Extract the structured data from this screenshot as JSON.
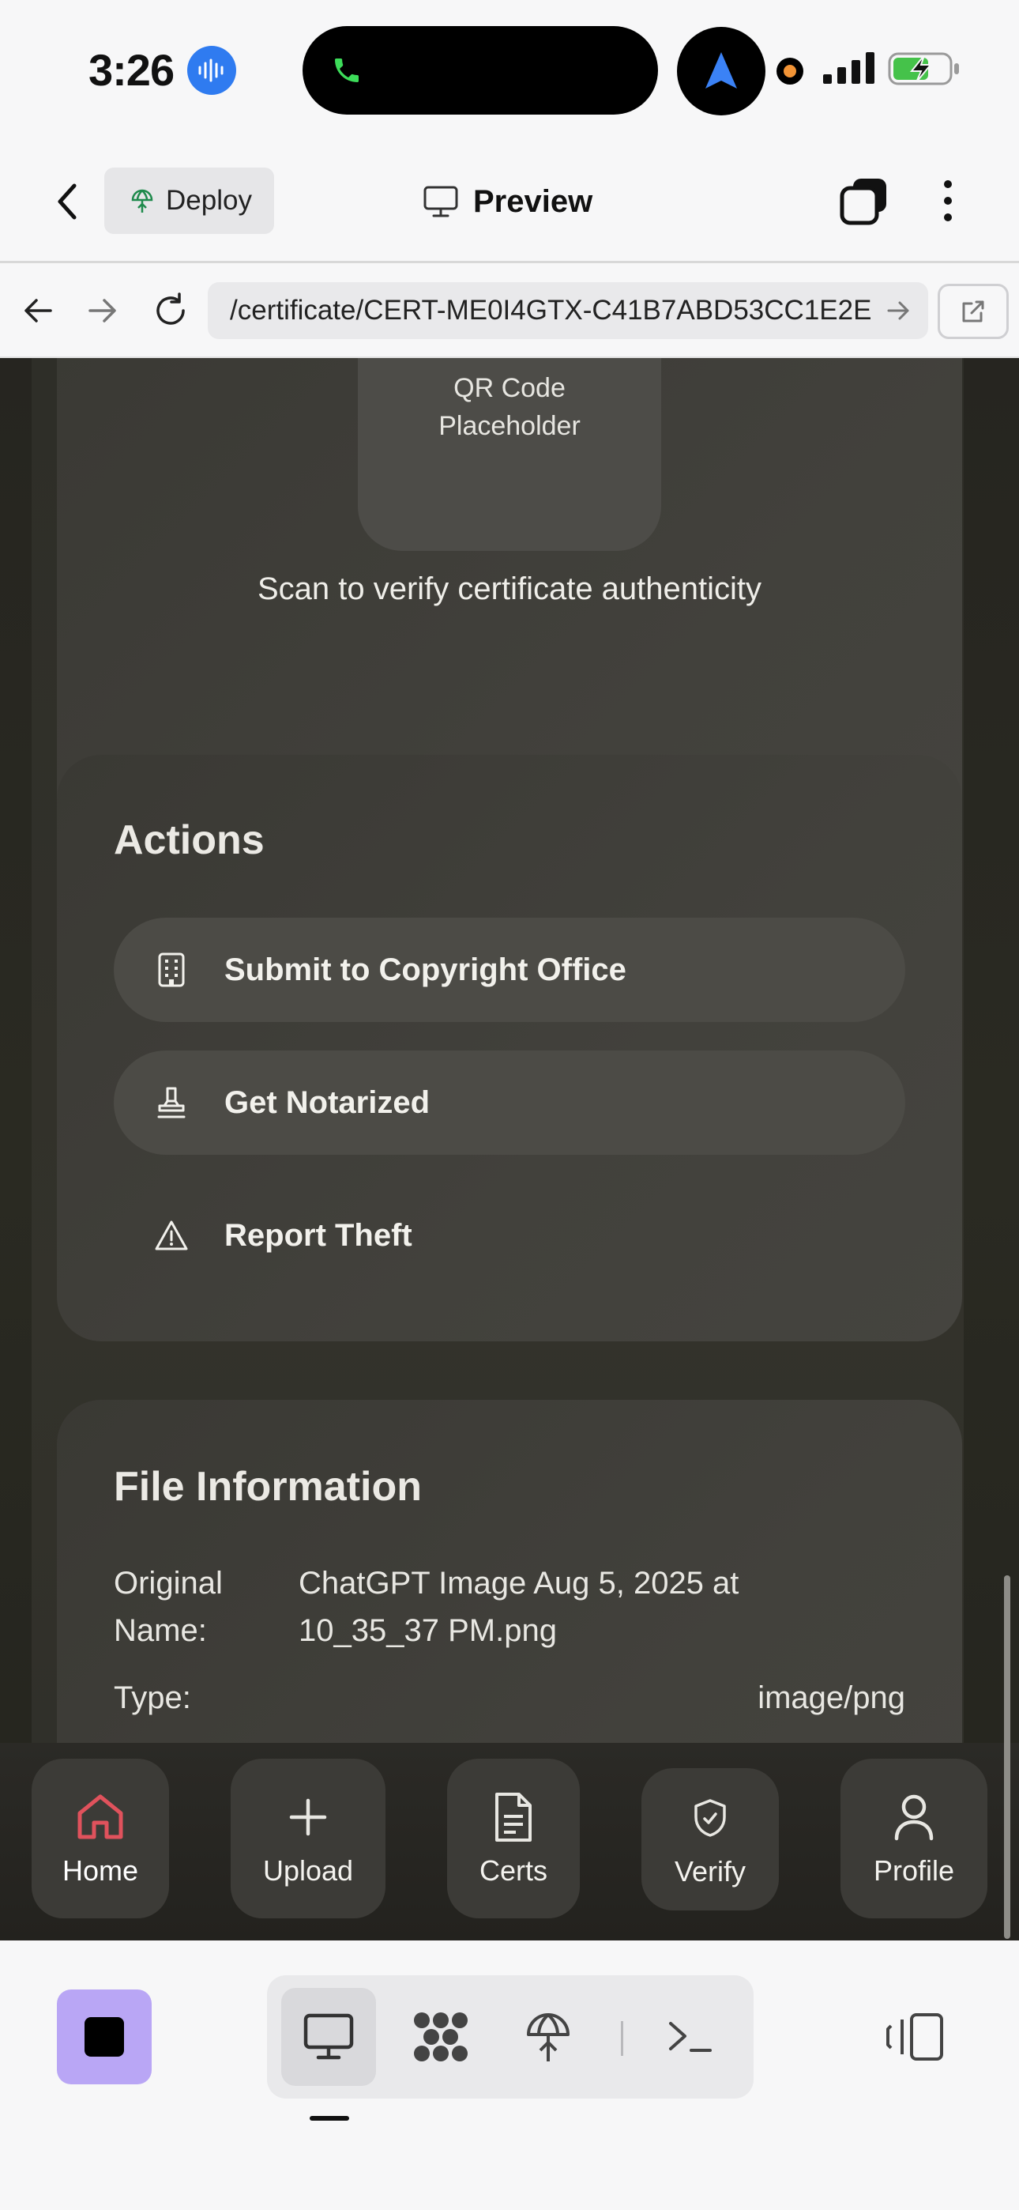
{
  "status_bar": {
    "time": "3:26"
  },
  "header": {
    "deploy_label": "Deploy",
    "preview_label": "Preview"
  },
  "url_bar": {
    "url": "/certificate/CERT-ME0I4GTX-C41B7ABD53CC1E2E"
  },
  "qr": {
    "placeholder_line1": "QR Code",
    "placeholder_line2": "Placeholder",
    "caption": "Scan to verify certificate authenticity"
  },
  "actions": {
    "title": "Actions",
    "items": [
      {
        "label": "Submit to Copyright Office",
        "icon": "building-icon"
      },
      {
        "label": "Get Notarized",
        "icon": "stamp-icon"
      },
      {
        "label": "Report Theft",
        "icon": "warning-icon"
      }
    ]
  },
  "file_info": {
    "title": "File Information",
    "original_name_key_line1": "Original",
    "original_name_key_line2": "Name:",
    "original_name_value_line1": "ChatGPT Image Aug 5, 2025 at",
    "original_name_value_line2": "10_35_37 PM.png",
    "type_key": "Type:",
    "type_value": "image/png"
  },
  "tabbar": {
    "items": [
      {
        "label": "Home",
        "icon": "home-icon",
        "active": true
      },
      {
        "label": "Upload",
        "icon": "plus-icon"
      },
      {
        "label": "Certs",
        "icon": "document-icon"
      },
      {
        "label": "Verify",
        "icon": "shield-icon"
      },
      {
        "label": "Profile",
        "icon": "user-icon"
      }
    ]
  },
  "colors": {
    "accent_home": "#e0525c",
    "stop_button": "#b9a6f5",
    "card_bg": "#403f3a"
  }
}
